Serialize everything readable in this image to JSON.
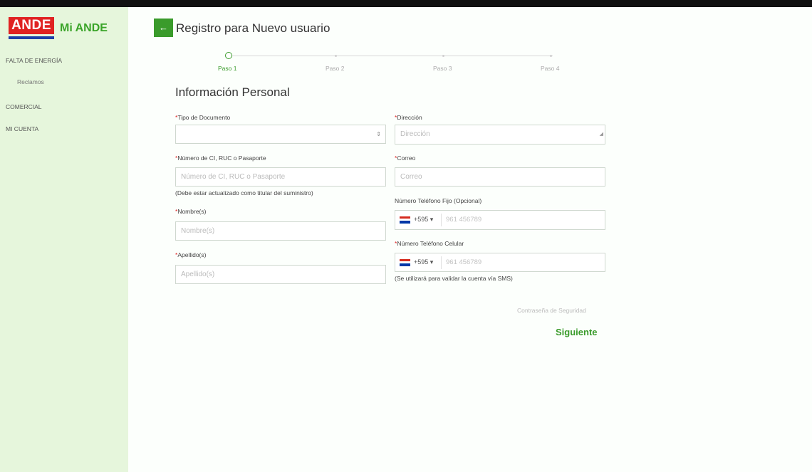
{
  "app": {
    "logo_text": "ANDE",
    "name": "Mi ANDE"
  },
  "sidebar": {
    "items": [
      {
        "label": "FALTA DE ENERGÍA"
      },
      {
        "label": "Reclamos"
      },
      {
        "label": "COMERCIAL"
      },
      {
        "label": "MI CUENTA"
      }
    ]
  },
  "header": {
    "back_icon": "←",
    "title": "Registro para Nuevo usuario"
  },
  "stepper": {
    "steps": [
      {
        "label": "Paso 1",
        "active": true
      },
      {
        "label": "Paso 2",
        "active": false
      },
      {
        "label": "Paso 3",
        "active": false
      },
      {
        "label": "Paso 4",
        "active": false
      }
    ]
  },
  "form": {
    "section_title": "Información Personal",
    "required_mark": "*",
    "tipo_documento": {
      "label": "Tipo de Documento",
      "value": "",
      "arrow": "⇕"
    },
    "numero_documento": {
      "label": "Número de CI, RUC o Pasaporte",
      "placeholder": "Número de CI, RUC o Pasaporte",
      "hint": "(Debe estar actualizado como titular del suministro)"
    },
    "nombres": {
      "label": "Nombre(s)",
      "placeholder": "Nombre(s)"
    },
    "apellidos": {
      "label": "Apellido(s)",
      "placeholder": "Apellido(s)"
    },
    "direccion": {
      "label": "Dirección",
      "placeholder": "Dirección"
    },
    "correo": {
      "label": "Correo",
      "placeholder": "Correo"
    },
    "telefono_fijo": {
      "label": "Número Teléfono Fijo (Opcional)",
      "prefix": "+595 ▾",
      "placeholder": "961 456789"
    },
    "telefono_celular": {
      "label": "Número Teléfono Celular",
      "prefix": "+595 ▾",
      "placeholder": "961 456789",
      "hint": "(Se utilizará para validar la cuenta vía SMS)"
    }
  },
  "footer": {
    "security_link": "Contraseña de Seguridad",
    "next_label": "Siguiente"
  },
  "colors": {
    "accent": "#3a9b2b",
    "sidebar_bg": "#e6f6dc",
    "required": "#e02222"
  }
}
